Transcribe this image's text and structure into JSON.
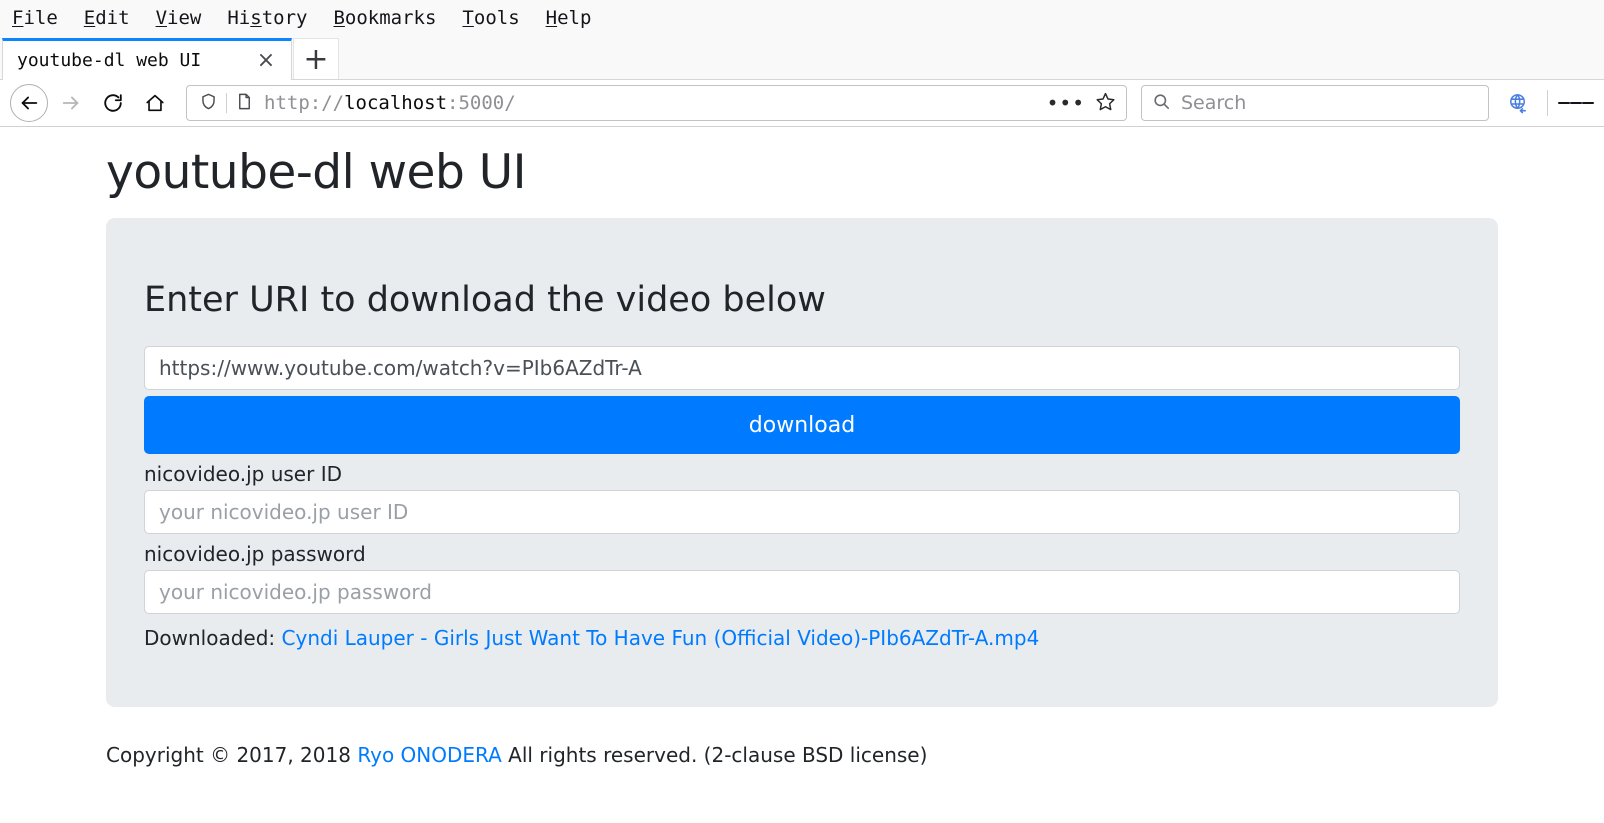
{
  "browser": {
    "menu": [
      {
        "label": "File",
        "mnemonic": "F"
      },
      {
        "label": "Edit",
        "mnemonic": "E"
      },
      {
        "label": "View",
        "mnemonic": "V"
      },
      {
        "label": "History",
        "mnemonic": "s"
      },
      {
        "label": "Bookmarks",
        "mnemonic": "B"
      },
      {
        "label": "Tools",
        "mnemonic": "T"
      },
      {
        "label": "Help",
        "mnemonic": "H"
      }
    ],
    "tab": {
      "title": "youtube-dl web UI",
      "close_label": "×",
      "new_tab_label": "+"
    },
    "nav": {
      "back_icon": "back-arrow-icon",
      "forward_icon": "forward-arrow-icon",
      "reload_icon": "reload-icon",
      "home_icon": "home-icon"
    },
    "url": {
      "scheme": "http://",
      "host": "localhost",
      "rest": ":5000/",
      "full": "http://localhost:5000/",
      "shield_icon": "shield-icon",
      "page_icon": "page-info-icon",
      "page_actions_label": "•••",
      "bookmark_icon": "star-icon"
    },
    "search": {
      "placeholder": "Search",
      "icon": "search-icon"
    },
    "sync_icon": "sync-globe-icon",
    "menu_icon": "hamburger-menu-icon",
    "accent_color": "#0a84ff"
  },
  "page": {
    "title": "youtube-dl web UI",
    "jumbotron": {
      "heading": "Enter URI to download the video below",
      "uri_input": {
        "value": "https://www.youtube.com/watch?v=PIb6AZdTr-A",
        "placeholder": "https://www.youtube.com/watch?v=PIb6AZdTr-A"
      },
      "download_button": "download",
      "user_id": {
        "label": "nicovideo.jp user ID",
        "value": "",
        "placeholder": "your nicovideo.jp user ID"
      },
      "password": {
        "label": "nicovideo.jp password",
        "value": "",
        "placeholder": "your nicovideo.jp password"
      },
      "downloaded": {
        "prefix": "Downloaded:",
        "file_link": "Cyndi Lauper - Girls Just Want To Have Fun (Official Video)-PIb6AZdTr-A.mp4"
      },
      "button_color": "#007bff",
      "background_color": "#e9ecef"
    },
    "footer": {
      "before": "Copyright © 2017, 2018",
      "author_link": "Ryo ONODERA",
      "after": "All rights reserved. (2-clause BSD license)"
    }
  }
}
